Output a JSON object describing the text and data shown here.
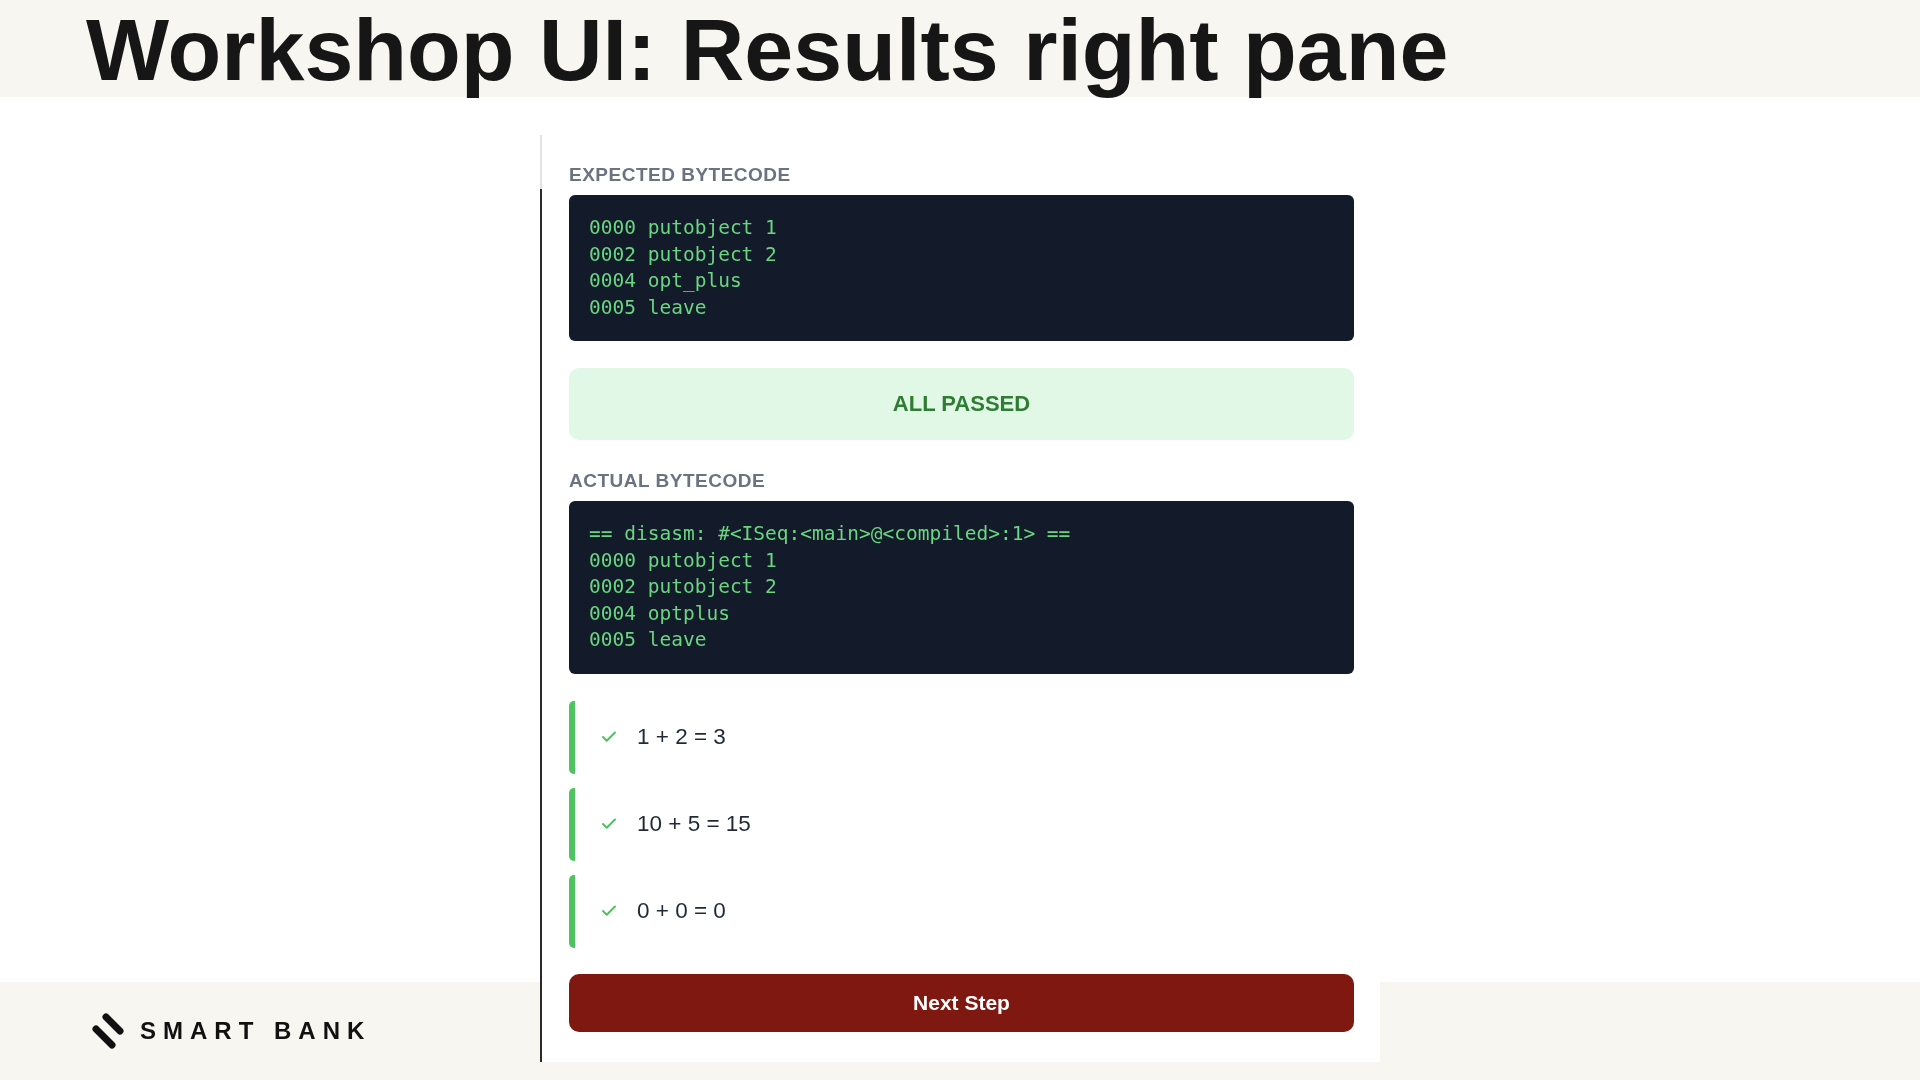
{
  "slide": {
    "title": "Workshop UI: Results right pane"
  },
  "results_pane": {
    "expected": {
      "label": "EXPECTED BYTECODE",
      "lines": [
        "0000 putobject 1",
        "0002 putobject 2",
        "0004 opt_plus",
        "0005 leave"
      ]
    },
    "status": {
      "text": "ALL PASSED",
      "passed": true
    },
    "actual": {
      "label": "ACTUAL BYTECODE",
      "lines": [
        "== disasm: #<ISeq:<main>@<compiled>:1> ==",
        "0000 putobject 1",
        "0002 putobject 2",
        "0004 optplus",
        "0005 leave"
      ]
    },
    "tests": [
      {
        "expression": "1 + 2 = 3",
        "passed": true
      },
      {
        "expression": "10 + 5 = 15",
        "passed": true
      },
      {
        "expression": "0 + 0 = 0",
        "passed": true
      }
    ],
    "next_button": "Next Step"
  },
  "footer": {
    "logo_text": "SMART BANK"
  }
}
